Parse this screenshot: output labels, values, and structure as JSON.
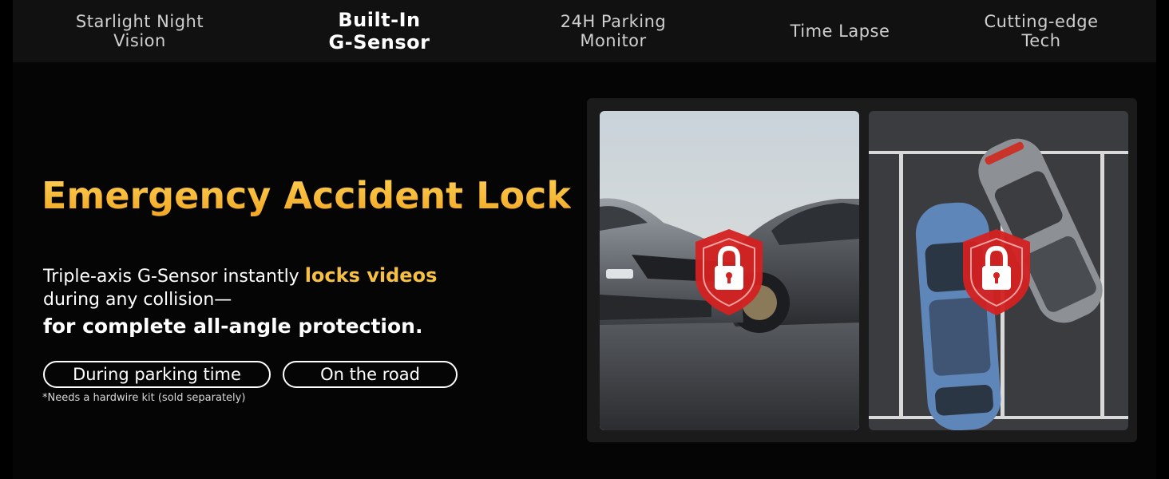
{
  "tabs": [
    {
      "label": "Starlight Night\nVision",
      "active": false
    },
    {
      "label": "Built-In\nG-Sensor",
      "active": true
    },
    {
      "label": "24H Parking\nMonitor",
      "active": false
    },
    {
      "label": "Time Lapse",
      "active": false
    },
    {
      "label": "Cutting-edge\nTech",
      "active": false
    }
  ],
  "main": {
    "headline": "Emergency Accident Lock",
    "desc_before": "Triple-axis G-Sensor instantly ",
    "desc_highlight": "locks videos",
    "desc_line2": "during any collision—",
    "desc_line3": "for complete all-angle protection.",
    "buttons": [
      "During parking time",
      "On the road"
    ],
    "note": "*Needs a hardwire kit (sold separately)"
  },
  "colors": {
    "headline_gradient": [
      "#ffd45a",
      "#f0a21c"
    ],
    "highlight": "#f7c043",
    "lock_shield": "#d42121"
  },
  "images": [
    {
      "name": "side-collision-photo",
      "icon": "lock-shield-icon"
    },
    {
      "name": "parking-lot-collision-photo",
      "icon": "lock-shield-icon"
    }
  ]
}
